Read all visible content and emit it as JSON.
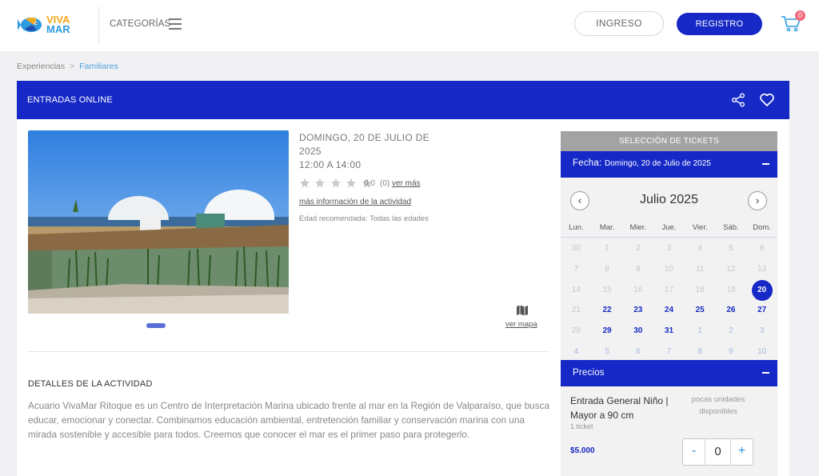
{
  "header": {
    "logo_line1": "VIVA",
    "logo_line2": "MAR",
    "categories_label": "CATEGORÍAS",
    "login_label": "INGRESO",
    "register_label": "REGISTRO",
    "cart_count": "0"
  },
  "breadcrumb": {
    "items": [
      "Experiencias",
      "Familiares"
    ],
    "separator": ">"
  },
  "card": {
    "title": "ENTRADAS ONLINE"
  },
  "event": {
    "date": "DOMINGO, 20 DE JULIO DE 2025",
    "time": "12:00 A 14:00",
    "rating_score": "0,0",
    "rating_count": "(0)",
    "rating_link": "ver más",
    "more_info": "más información de la actividad",
    "age": "Edad recomendada: Todas las edades",
    "map_link": "ver mapa"
  },
  "details": {
    "title": "DETALLES DE LA ACTIVIDAD",
    "body": "Acuario VivaMar Ritoque es un Centro de Interpretación Marina ubicado frente al mar en la Región de Valparaíso, que busca educar, emocionar y conectar. Combinamos educación ambiental, entretención familiar y conservación marina con una mirada sostenible y accesible para todos. Creemos que conocer el mar es el primer paso para protegerlo."
  },
  "tickets": {
    "header": "SELECCIÓN DE TICKETS",
    "fecha_label": "Fecha:",
    "fecha_value": "Domingo, 20 de Julio de 2025",
    "calendar": {
      "month": "Julio 2025",
      "prev": "‹",
      "next": "›",
      "weekdays": [
        "Lun.",
        "Mar.",
        "Mier.",
        "Jue.",
        "Vier.",
        "Sáb.",
        "Dom."
      ],
      "weeks": [
        [
          {
            "d": "30",
            "s": "prev"
          },
          {
            "d": "1",
            "s": "past"
          },
          {
            "d": "2",
            "s": "past"
          },
          {
            "d": "3",
            "s": "past"
          },
          {
            "d": "4",
            "s": "past"
          },
          {
            "d": "5",
            "s": "past"
          },
          {
            "d": "6",
            "s": "past"
          }
        ],
        [
          {
            "d": "7",
            "s": "past"
          },
          {
            "d": "8",
            "s": "past"
          },
          {
            "d": "9",
            "s": "past"
          },
          {
            "d": "10",
            "s": "past"
          },
          {
            "d": "11",
            "s": "past"
          },
          {
            "d": "12",
            "s": "past"
          },
          {
            "d": "13",
            "s": "past"
          }
        ],
        [
          {
            "d": "14",
            "s": "past"
          },
          {
            "d": "15",
            "s": "past"
          },
          {
            "d": "16",
            "s": "past"
          },
          {
            "d": "17",
            "s": "past"
          },
          {
            "d": "18",
            "s": "past"
          },
          {
            "d": "19",
            "s": "past"
          },
          {
            "d": "20",
            "s": "sel"
          }
        ],
        [
          {
            "d": "21",
            "s": "past"
          },
          {
            "d": "22",
            "s": "avail"
          },
          {
            "d": "23",
            "s": "avail"
          },
          {
            "d": "24",
            "s": "avail"
          },
          {
            "d": "25",
            "s": "avail"
          },
          {
            "d": "26",
            "s": "avail"
          },
          {
            "d": "27",
            "s": "avail"
          }
        ],
        [
          {
            "d": "28",
            "s": "past"
          },
          {
            "d": "29",
            "s": "avail"
          },
          {
            "d": "30",
            "s": "avail"
          },
          {
            "d": "31",
            "s": "avail"
          },
          {
            "d": "1",
            "s": "next"
          },
          {
            "d": "2",
            "s": "next"
          },
          {
            "d": "3",
            "s": "next"
          }
        ],
        [
          {
            "d": "4",
            "s": "next"
          },
          {
            "d": "5",
            "s": "next"
          },
          {
            "d": "6",
            "s": "next"
          },
          {
            "d": "7",
            "s": "next"
          },
          {
            "d": "8",
            "s": "next"
          },
          {
            "d": "9",
            "s": "next"
          },
          {
            "d": "10",
            "s": "next"
          }
        ]
      ]
    },
    "precios_label": "Precios",
    "ticket": {
      "name": "Entrada General Niño | Mayor a 90 cm",
      "availability": "pocas unidades disponibles",
      "qty_label": "1 ticket",
      "price": "$5.000",
      "stepper_minus": "-",
      "stepper_value": "0",
      "stepper_plus": "+"
    }
  },
  "colors": {
    "brand_blue": "#1629c6",
    "link_blue": "#4aa3df",
    "logo_yellow": "#f3a81b",
    "badge": "#f26b7c"
  }
}
